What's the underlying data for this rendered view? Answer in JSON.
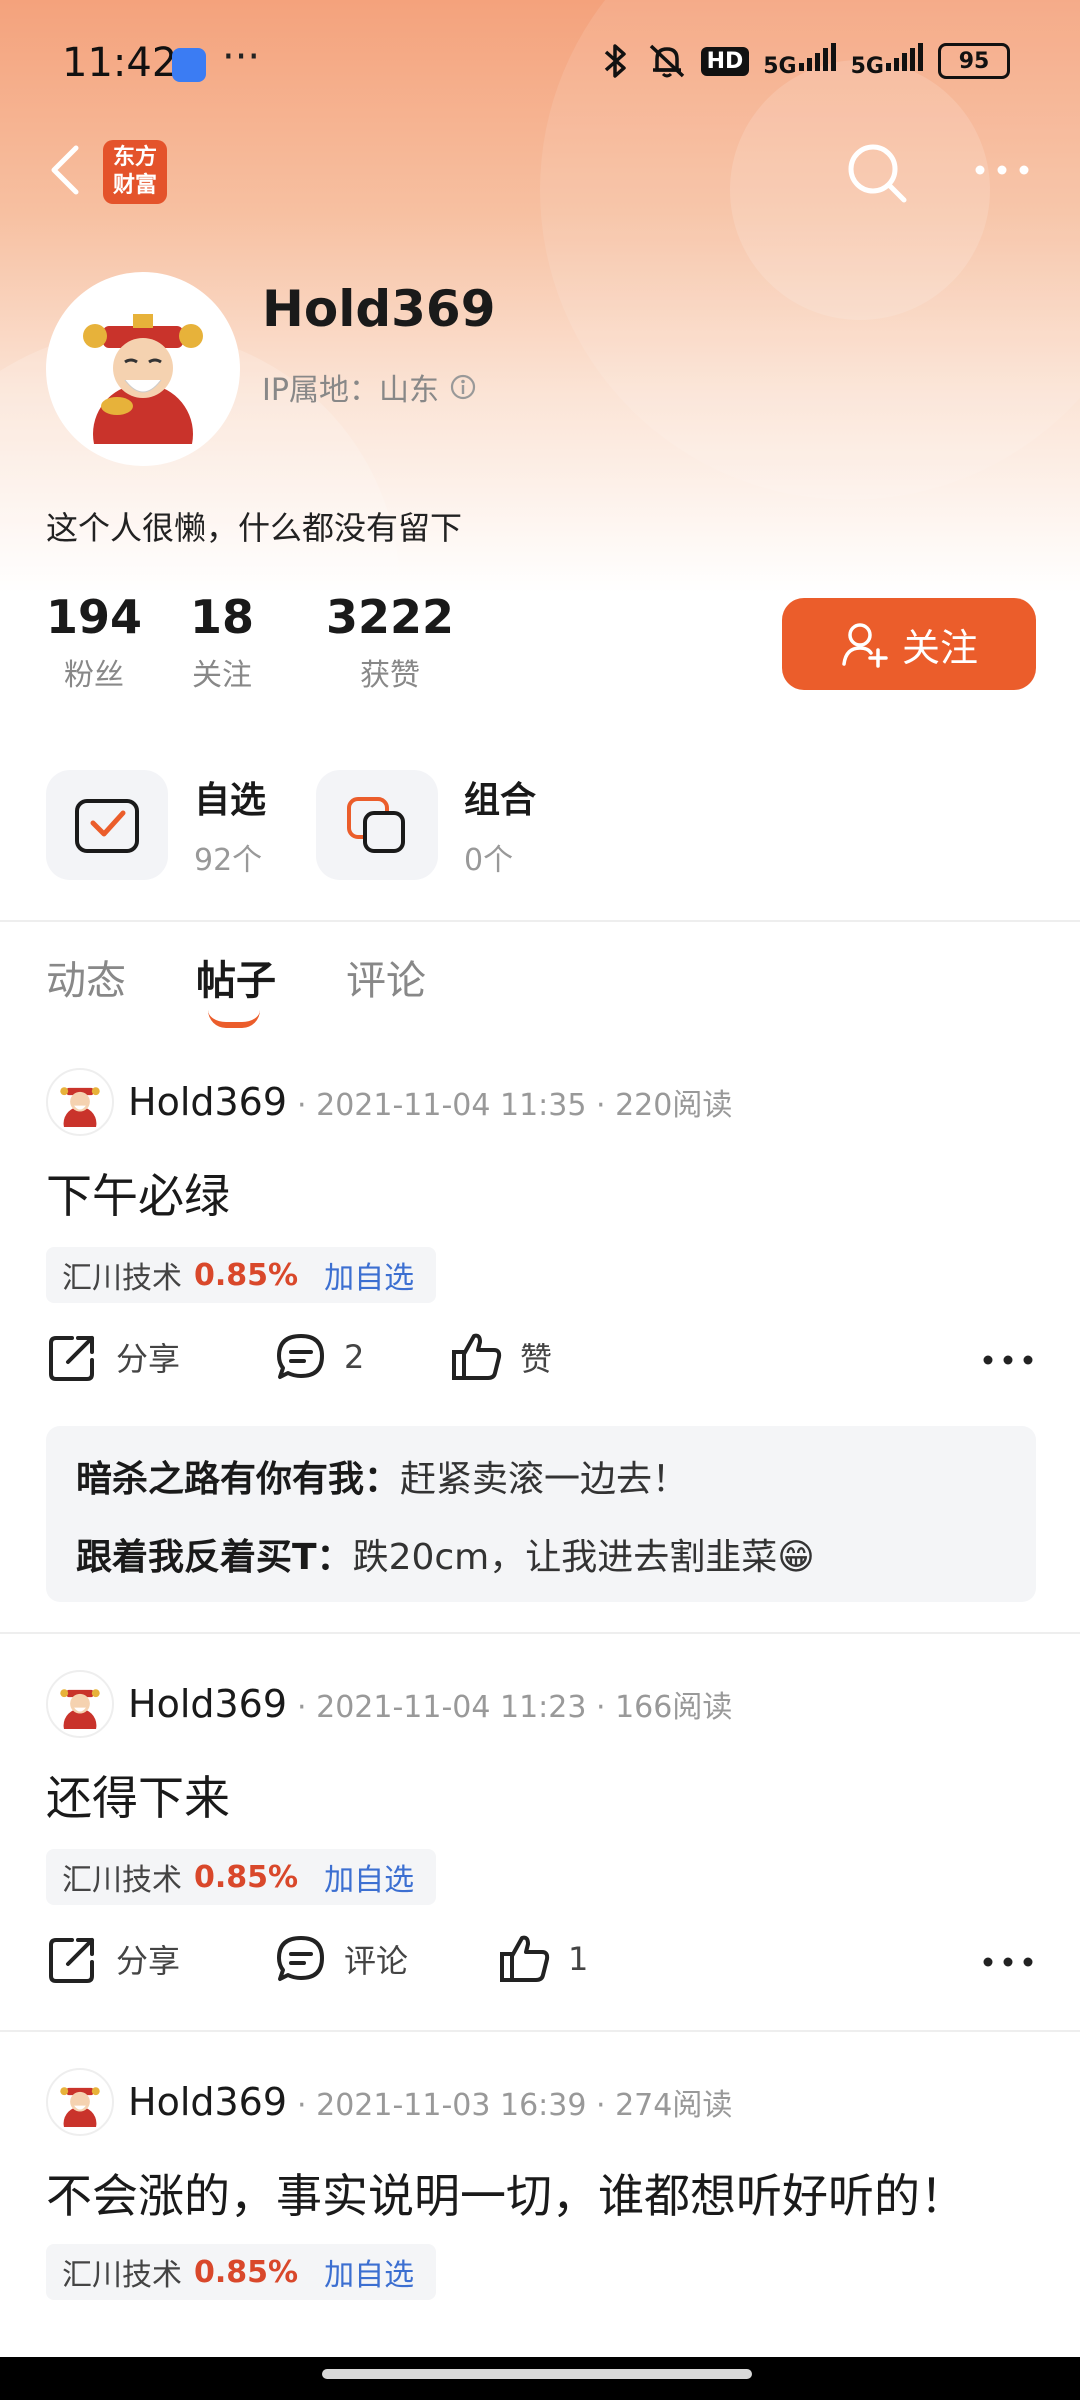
{
  "status_bar": {
    "time": "11:42",
    "more": "···",
    "signal_1": "5G",
    "signal_2": "5G",
    "hd": "HD",
    "battery": "95"
  },
  "nav": {
    "logo_line1": "东方",
    "logo_line2": "财富"
  },
  "profile": {
    "username": "Hold369",
    "ip_location": "IP属地：山东",
    "bio": "这个人很懒，什么都没有留下",
    "stats": [
      {
        "value": "194",
        "label": "粉丝"
      },
      {
        "value": "18",
        "label": "关注"
      },
      {
        "value": "3222",
        "label": "获赞"
      }
    ],
    "follow_label": "关注"
  },
  "quick_access": [
    {
      "title": "自选",
      "sub": "92个"
    },
    {
      "title": "组合",
      "sub": "0个"
    }
  ],
  "tabs": [
    {
      "label": "动态",
      "active": false
    },
    {
      "label": "帖子",
      "active": true
    },
    {
      "label": "评论",
      "active": false
    }
  ],
  "posts": [
    {
      "author": "Hold369",
      "meta": "· 2021-11-04 11:35 · 220阅读",
      "title": "下午必绿",
      "stock": {
        "name": "汇川技术",
        "change": "0.85%",
        "add": "加自选"
      },
      "share": "分享",
      "comments": "2",
      "likes": "赞",
      "replies": [
        {
          "user": "暗杀之路有你有我：",
          "text": "赶紧卖滚一边去！"
        },
        {
          "user": "跟着我反着买T：",
          "text": "跌20cm，让我进去割韭菜😁"
        }
      ]
    },
    {
      "author": "Hold369",
      "meta": "· 2021-11-04 11:23 · 166阅读",
      "title": "还得下来",
      "stock": {
        "name": "汇川技术",
        "change": "0.85%",
        "add": "加自选"
      },
      "share": "分享",
      "comments": "评论",
      "likes": "1"
    },
    {
      "author": "Hold369",
      "meta": "· 2021-11-03 16:39 · 274阅读",
      "title": "不会涨的，事实说明一切，谁都想听好听的！",
      "stock": {
        "name": "汇川技术",
        "change": "0.85%",
        "add": "加自选"
      }
    }
  ],
  "colors": {
    "accent": "#eb5d2b",
    "gain": "#d9482b",
    "link": "#3c6fd1"
  }
}
